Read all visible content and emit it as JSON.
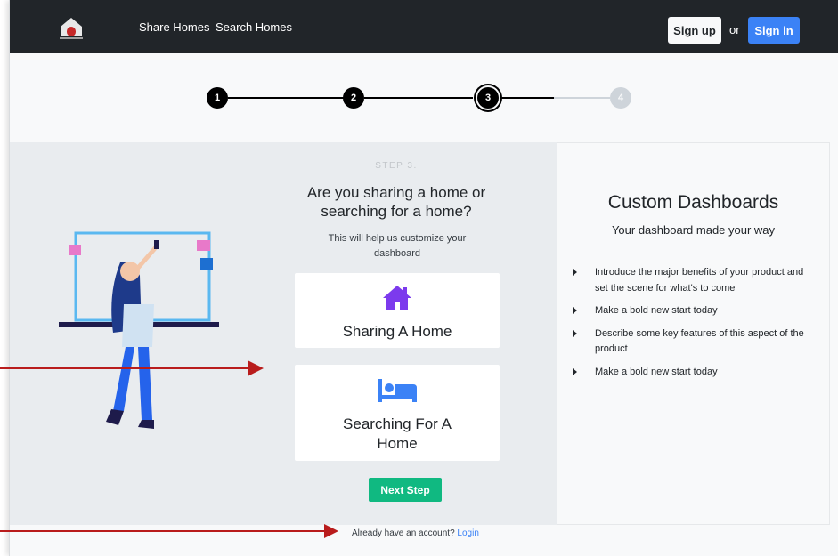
{
  "navbar": {
    "links": [
      "Share Homes",
      "Search Homes"
    ],
    "signup_label": "Sign up",
    "or_text": "or",
    "signin_label": "Sign in",
    "logo_icon": "house-logo-icon"
  },
  "stepper": {
    "steps": [
      "1",
      "2",
      "3",
      "4"
    ],
    "active_step": 3
  },
  "step_panel": {
    "step_label": "STEP 3.",
    "question": "Are you sharing a home or searching for a home?",
    "subtext": "This will help us customize your dashboard",
    "options": [
      {
        "label": "Sharing A Home",
        "icon": "home-icon"
      },
      {
        "label": "Searching For A Home",
        "icon": "bed-icon"
      }
    ],
    "next_label": "Next Step",
    "account_text": "Already have an account?",
    "login_label": "Login"
  },
  "sidebar": {
    "title": "Custom Dashboards",
    "subtitle": "Your dashboard made your way",
    "items": [
      "Introduce the major benefits of your product and set the scene for what's to come",
      "Make a bold new start today",
      "Describe some key features of this aspect of the product",
      "Make a bold new start today"
    ]
  },
  "colors": {
    "navbar": "#212529",
    "signin": "#3b82f6",
    "next": "#10b981",
    "icon_purple": "#7c3aed",
    "icon_blue": "#3b82f6",
    "arrow": "#b91c1c"
  }
}
